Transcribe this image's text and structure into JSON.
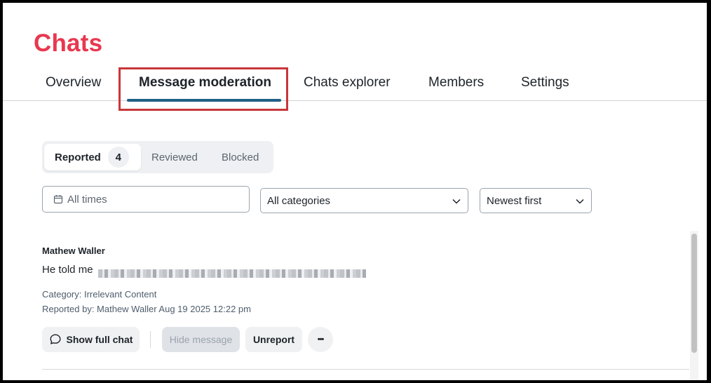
{
  "page": {
    "title": "Chats"
  },
  "tabs": [
    {
      "label": "Overview"
    },
    {
      "label": "Message moderation",
      "active": true
    },
    {
      "label": "Chats explorer"
    },
    {
      "label": "Members"
    },
    {
      "label": "Settings"
    }
  ],
  "filters": {
    "segments": [
      {
        "label": "Reported",
        "count": "4",
        "active": true
      },
      {
        "label": "Reviewed"
      },
      {
        "label": "Blocked"
      }
    ],
    "date": {
      "label": "All times",
      "icon": "calendar-icon"
    },
    "category": {
      "selected": "All categories"
    },
    "sort": {
      "selected": "Newest first"
    }
  },
  "messages": [
    {
      "author": "Mathew Waller",
      "text_prefix": "He told me",
      "category_line": "Category: Irrelevant Content",
      "reported_line": "Reported by: Mathew Waller Aug 19 2025 12:22 pm",
      "actions": {
        "show_chat": "Show full chat",
        "hide": "Hide message",
        "unreport": "Unreport",
        "more": "•••"
      }
    }
  ],
  "colors": {
    "title": "#e8384f",
    "tab_underline": "#1f5f86",
    "highlight_box": "#c8363a"
  }
}
